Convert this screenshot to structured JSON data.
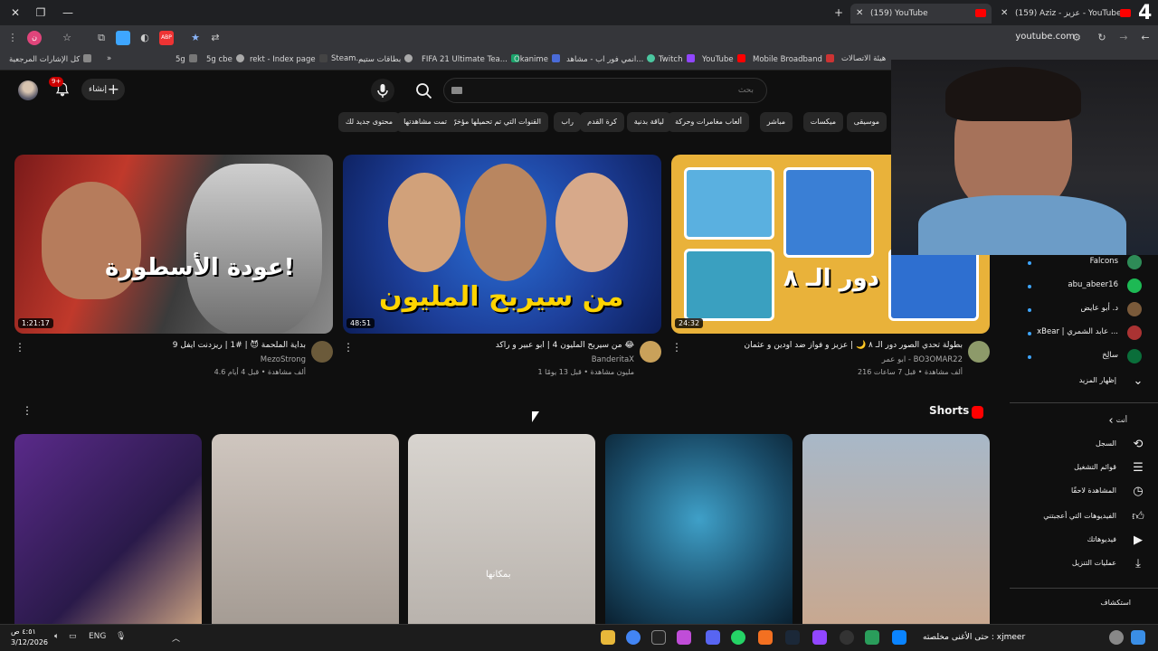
{
  "browser": {
    "tabs": [
      {
        "title": "(159) YouTube",
        "active": true
      },
      {
        "title": "(159) Aziz - عزيز - YouTube",
        "active": false
      }
    ],
    "url": "youtube.com",
    "bookmarks": [
      "كل الإشارات المرجعية",
      "5g",
      "5g cbe",
      "rekt - Index page",
      "Steam...",
      "بطاقات ستيم",
      "FIFA 21 Ultimate Tea...",
      "Okanime",
      "انمي فور اب - مشاهد...",
      "Twitch",
      "YouTube",
      "Mobile Broadband",
      "هيئة الاتصالات",
      "YouTube"
    ]
  },
  "header": {
    "create_label": "إنشاء",
    "notif_count": "9+",
    "search_placeholder": "بحث"
  },
  "chips": [
    "موسيقى",
    "ميكسات",
    "مباشر",
    "ألعاب مغامرات وحركة",
    "لياقة بدنية",
    "كرة القدم",
    "راب",
    "القنوات التي تم تحميلها مؤخرًا",
    "تمت مشاهدتها",
    "محتوى جديد لك"
  ],
  "videos": [
    {
      "title": "بداية الملحمة 😈 | #1 | ريزدنت ايفل 9",
      "channel": "MezoStrong",
      "meta": "4.6 ألف مشاهدة • قبل 4 أيام",
      "duration": "1:21:17",
      "overlay": "عودة الأسطورة!"
    },
    {
      "title": "من سيربح المليون 4 | ابو عبير و راكد 😂",
      "channel": "BanderitaX",
      "meta": "1 مليون مشاهدة • قبل 13 يومًا",
      "duration": "48:51",
      "overlay": "من سيربح المليون"
    },
    {
      "title": "بطولة تحدي الصور دور الـ ٨ 🌙 | عزيز و فواز ضد اودين و عثمان",
      "channel": "ابو عمر - BO3OMAR22",
      "meta": "216 ألف مشاهدة • قبل 7 ساعات",
      "duration": "24:32",
      "overlay": "دور الـ ٨"
    }
  ],
  "shorts": {
    "title": "Shorts",
    "items": [
      {
        "caption": ""
      },
      {
        "caption": ""
      },
      {
        "caption": "بمكانها"
      },
      {
        "caption": ""
      },
      {
        "caption": ""
      }
    ]
  },
  "sidebar": {
    "subscriptions": [
      {
        "name": "Falcons",
        "live": true,
        "color": "#2e8b57"
      },
      {
        "name": "abu_abeer16",
        "live": true,
        "color": "#1db954"
      },
      {
        "name": "د. أبو عايض",
        "live": true,
        "color": "#7a5a3a"
      },
      {
        "name": "xBear | عابد الشمري ...",
        "live": true,
        "color": "#a33"
      },
      {
        "name": "سالِخ",
        "live": true,
        "color": "#0a6e3a"
      }
    ],
    "show_more": "إظهار المزيد",
    "you_title": "أنت",
    "you_items": [
      {
        "label": "السجل",
        "icon": "history-icon"
      },
      {
        "label": "قوائم التشغيل",
        "icon": "playlist-icon"
      },
      {
        "label": "المشاهدة لاحقًا",
        "icon": "clock-icon"
      },
      {
        "label": "الفيديوهات التي أعجبتني",
        "icon": "like-icon"
      },
      {
        "label": "فيديوهاتك",
        "icon": "video-icon"
      },
      {
        "label": "عمليات التنزيل",
        "icon": "download-icon"
      }
    ],
    "explore_title": "استكشاف"
  },
  "taskbar": {
    "time": "٤:٥١ ص",
    "date": "3/12/2026",
    "lang": "ENG",
    "ticker": "حتى الأغنى مخلصته : xjmeer",
    "number": "4"
  }
}
